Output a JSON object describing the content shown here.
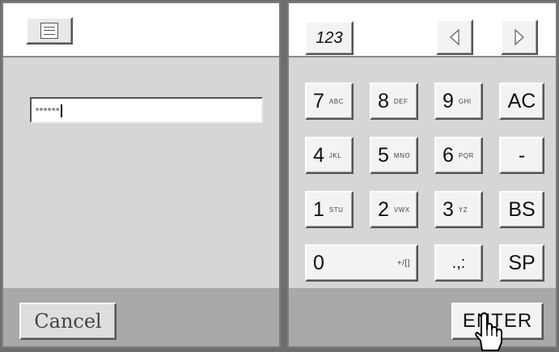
{
  "left_panel": {
    "password_value": "******",
    "cancel_label": "Cancel"
  },
  "keypad": {
    "mode_label": "123",
    "keys": [
      {
        "main": "7",
        "sub": "ABC"
      },
      {
        "main": "8",
        "sub": "DEF"
      },
      {
        "main": "9",
        "sub": "GHI"
      },
      {
        "main": "AC",
        "sub": ""
      },
      {
        "main": "4",
        "sub": "JKL"
      },
      {
        "main": "5",
        "sub": "MNO"
      },
      {
        "main": "6",
        "sub": "PQR"
      },
      {
        "main": "-",
        "sub": ""
      },
      {
        "main": "1",
        "sub": "STU"
      },
      {
        "main": "2",
        "sub": "VWX"
      },
      {
        "main": "3",
        "sub": "YZ"
      },
      {
        "main": "BS",
        "sub": ""
      },
      {
        "main": "0",
        "sub": "+/[]"
      },
      {
        "main": ".,:",
        "sub": ""
      },
      {
        "main": "SP",
        "sub": ""
      }
    ],
    "enter_label": "ENTER"
  },
  "icons": {
    "menu": "menu-list-icon",
    "left": "triangle-left-icon",
    "right": "triangle-right-icon",
    "pointer": "hand-pointer-icon"
  }
}
